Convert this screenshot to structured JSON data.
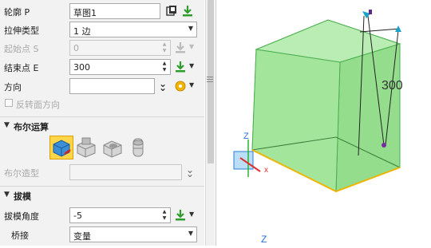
{
  "panel": {
    "profile": {
      "label": "轮廓 P",
      "value": "草图1"
    },
    "extrude_type": {
      "label": "拉伸类型",
      "value": "1 边"
    },
    "start_point": {
      "label": "起始点 S",
      "value": "0"
    },
    "end_point": {
      "label": "结束点 E",
      "value": "300"
    },
    "direction": {
      "label": "方向",
      "value": ""
    },
    "flip_face": {
      "label": "反转面方向",
      "checked": false
    }
  },
  "boolean_section": {
    "title": "布尔运算",
    "ops": [
      "boolean-base-icon",
      "boolean-add-icon",
      "boolean-subtract-icon",
      "boolean-intersect-icon"
    ],
    "shape_label": "布尔造型"
  },
  "draft_section": {
    "title": "拔模",
    "angle": {
      "label": "拔模角度",
      "value": "-5"
    },
    "bridge": {
      "label": "桥接",
      "value": "变量"
    }
  },
  "viewport": {
    "dimension_label": "300",
    "axis_label_z": "Z",
    "colors": {
      "solid_fill": "#9be39a",
      "solid_edge": "#3aa83a",
      "selected_edge": "#f0b400",
      "accent": "#1aa3c8"
    }
  }
}
